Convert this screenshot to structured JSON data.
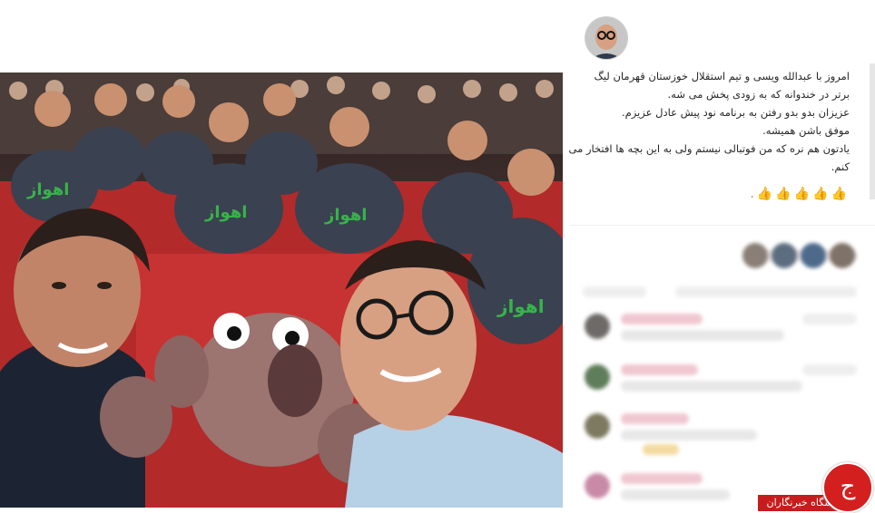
{
  "post": {
    "caption_lines": [
      "امروز با عبدالله ویسی و تیم استقلال خوزستان قهرمان لیگ",
      "برتر در خندوانه که به زودی پخش می شه.",
      "عزیزان بدو بدو رفتن به برنامه نود پیش عادل عزیزم.",
      "موفق باشن همیشه.",
      "یادتون هم نره که من فوتبالی نیستم ولی به این بچه ها افتخار می",
      "کنم."
    ],
    "emoji_line": "👍👍👍👍👍.",
    "shirt_text": "اهواز"
  },
  "watermark": {
    "logo_glyph": "ج",
    "label": "باشگاه خبرنگاران"
  },
  "colors": {
    "accent_red": "#d41f1f",
    "seat_red": "#a32424",
    "shirt_navy": "#3a4150",
    "shirt_green": "#37b34a"
  }
}
